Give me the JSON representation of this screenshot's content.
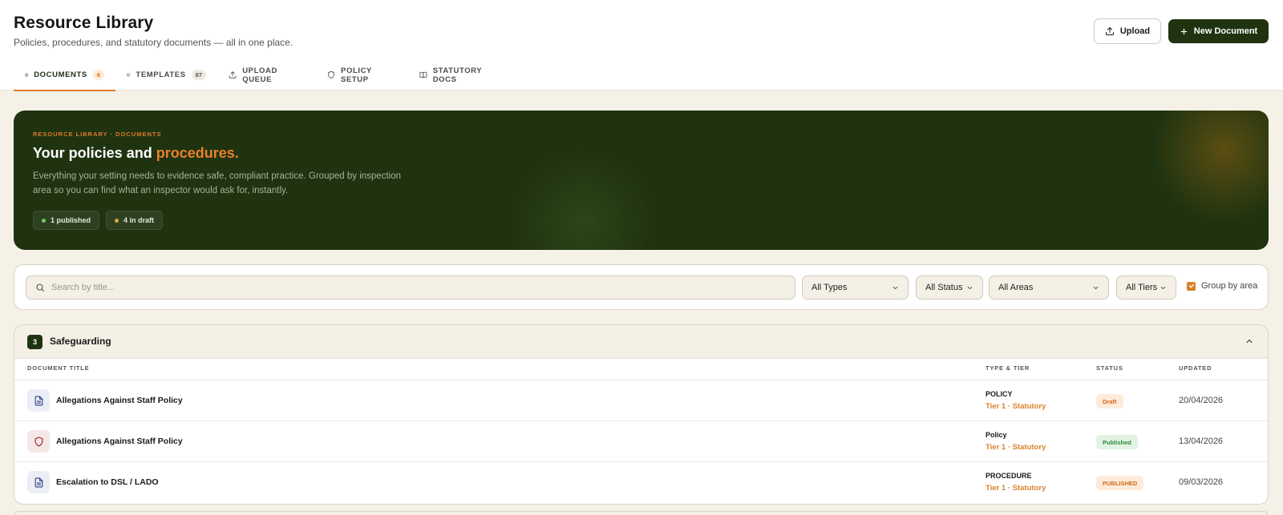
{
  "header": {
    "title": "Resource Library",
    "subtitle": "Policies, procedures, and statutory documents — all in one place.",
    "upload_label": "Upload",
    "new_document_label": "New Document"
  },
  "tabs": [
    {
      "label": "DOCUMENTS",
      "badge": "6",
      "active": true,
      "icon": "document-icon"
    },
    {
      "label": "TEMPLATES",
      "badge": "87",
      "active": false,
      "icon": "template-icon"
    },
    {
      "label": "UPLOAD QUEUE",
      "badge": null,
      "active": false,
      "icon": "upload-icon"
    },
    {
      "label": "POLICY SETUP",
      "badge": null,
      "active": false,
      "icon": "shield-icon"
    },
    {
      "label": "STATUTORY DOCS",
      "badge": null,
      "active": false,
      "icon": "book-icon"
    }
  ],
  "hero": {
    "eyebrow": "RESOURCE LIBRARY · DOCUMENTS",
    "title_prefix": "Your policies and",
    "title_accent": "procedures.",
    "description": "Everything your setting needs to evidence safe, compliant practice. Grouped by inspection area so you can find what an inspector would ask for, instantly.",
    "published_pill": "1 published",
    "draft_pill": "4 in draft"
  },
  "filters": {
    "search_placeholder": "Search by title...",
    "type": "All Types",
    "status": "All Status",
    "area": "All Areas",
    "tier": "All Tiers",
    "group_by_label": "Group by area",
    "group_by_checked": true
  },
  "section": {
    "count": "3",
    "name": "Safeguarding",
    "columns": {
      "title": "DOCUMENT TITLE",
      "type": "TYPE & TIER",
      "status": "STATUS",
      "updated": "UPDATED"
    },
    "rows": [
      {
        "title": "Allegations Against Staff Policy",
        "type": "POLICY",
        "tier": "Tier 1 · Statutory",
        "status": "Draft",
        "updated": "20/04/2026",
        "icon": "document-icon"
      },
      {
        "title": "Allegations Against Staff Policy",
        "type": "Policy",
        "tier": "Tier 1 · Statutory",
        "status": "Published",
        "updated": "13/04/2026",
        "icon": "shield-icon"
      },
      {
        "title": "Escalation to DSL / LADO",
        "type": "PROCEDURE",
        "tier": "Tier 1 · Statutory",
        "status": "PUBLISHED",
        "updated": "09/03/2026",
        "icon": "document-icon"
      }
    ]
  },
  "colors": {
    "brand_dark": "#1f3310",
    "accent_orange": "#e07b2a",
    "published_dot": "#6ecb63",
    "draft_dot": "#e0a832"
  }
}
